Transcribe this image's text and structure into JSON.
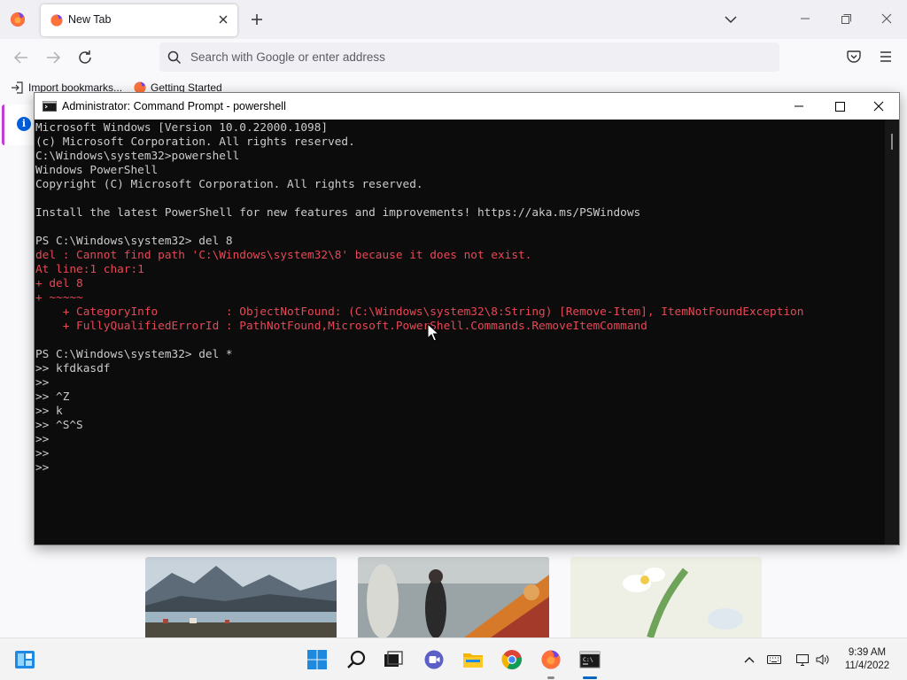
{
  "browser": {
    "tab": {
      "title": "New Tab"
    },
    "urlbar": {
      "placeholder": "Search with Google or enter address"
    },
    "bookmarks": [
      {
        "label": "Import bookmarks..."
      },
      {
        "label": "Getting Started"
      }
    ]
  },
  "console": {
    "title": "Administrator: Command Prompt - powershell",
    "lines": [
      {
        "text": "Microsoft Windows [Version 10.0.22000.1098]",
        "kind": "out"
      },
      {
        "text": "(c) Microsoft Corporation. All rights reserved.",
        "kind": "out"
      },
      {
        "text": "C:\\Windows\\system32>powershell",
        "kind": "out"
      },
      {
        "text": "Windows PowerShell",
        "kind": "out"
      },
      {
        "text": "Copyright (C) Microsoft Corporation. All rights reserved.",
        "kind": "out"
      },
      {
        "text": "",
        "kind": "out"
      },
      {
        "text": "Install the latest PowerShell for new features and improvements! https://aka.ms/PSWindows",
        "kind": "out"
      },
      {
        "text": "",
        "kind": "out"
      },
      {
        "text": "PS C:\\Windows\\system32> del 8",
        "kind": "out"
      },
      {
        "text": "del : Cannot find path 'C:\\Windows\\system32\\8' because it does not exist.",
        "kind": "err"
      },
      {
        "text": "At line:1 char:1",
        "kind": "err"
      },
      {
        "text": "+ del 8",
        "kind": "err"
      },
      {
        "text": "+ ~~~~~",
        "kind": "err"
      },
      {
        "text": "    + CategoryInfo          : ObjectNotFound: (C:\\Windows\\system32\\8:String) [Remove-Item], ItemNotFoundException",
        "kind": "err"
      },
      {
        "text": "    + FullyQualifiedErrorId : PathNotFound,Microsoft.PowerShell.Commands.RemoveItemCommand",
        "kind": "err"
      },
      {
        "text": "",
        "kind": "out"
      },
      {
        "text": "PS C:\\Windows\\system32> del *",
        "kind": "out"
      },
      {
        "text": ">> kfdkasdf",
        "kind": "out"
      },
      {
        "text": ">>",
        "kind": "out"
      },
      {
        "text": ">> ^Z",
        "kind": "out"
      },
      {
        "text": ">> k",
        "kind": "out"
      },
      {
        "text": ">> ^S^S",
        "kind": "out"
      },
      {
        "text": ">>",
        "kind": "out"
      },
      {
        "text": ">>",
        "kind": "out"
      },
      {
        "text": ">>",
        "kind": "out"
      }
    ]
  },
  "taskbar": {
    "clock": {
      "time": "9:39 AM",
      "date": "11/4/2022"
    }
  },
  "colors": {
    "console_bg": "#0c0c0c",
    "console_text": "#cccccc",
    "console_error": "#e74856",
    "firefox_accent": "#c53bd6"
  },
  "icons": {
    "browser": [
      "firefox-icon",
      "close-icon",
      "plus-icon",
      "chevron-down-icon",
      "minimize-icon",
      "restore-icon",
      "back-icon",
      "forward-icon",
      "reload-icon",
      "search-icon",
      "pocket-icon",
      "menu-icon",
      "import-icon",
      "info-icon"
    ],
    "taskbar": [
      "widgets-icon",
      "start-icon",
      "search-icon",
      "task-view-icon",
      "chat-icon",
      "file-explorer-icon",
      "chrome-icon",
      "firefox-icon",
      "terminal-icon",
      "chevron-up-icon",
      "keyboard-icon",
      "network-icon",
      "volume-icon"
    ]
  }
}
